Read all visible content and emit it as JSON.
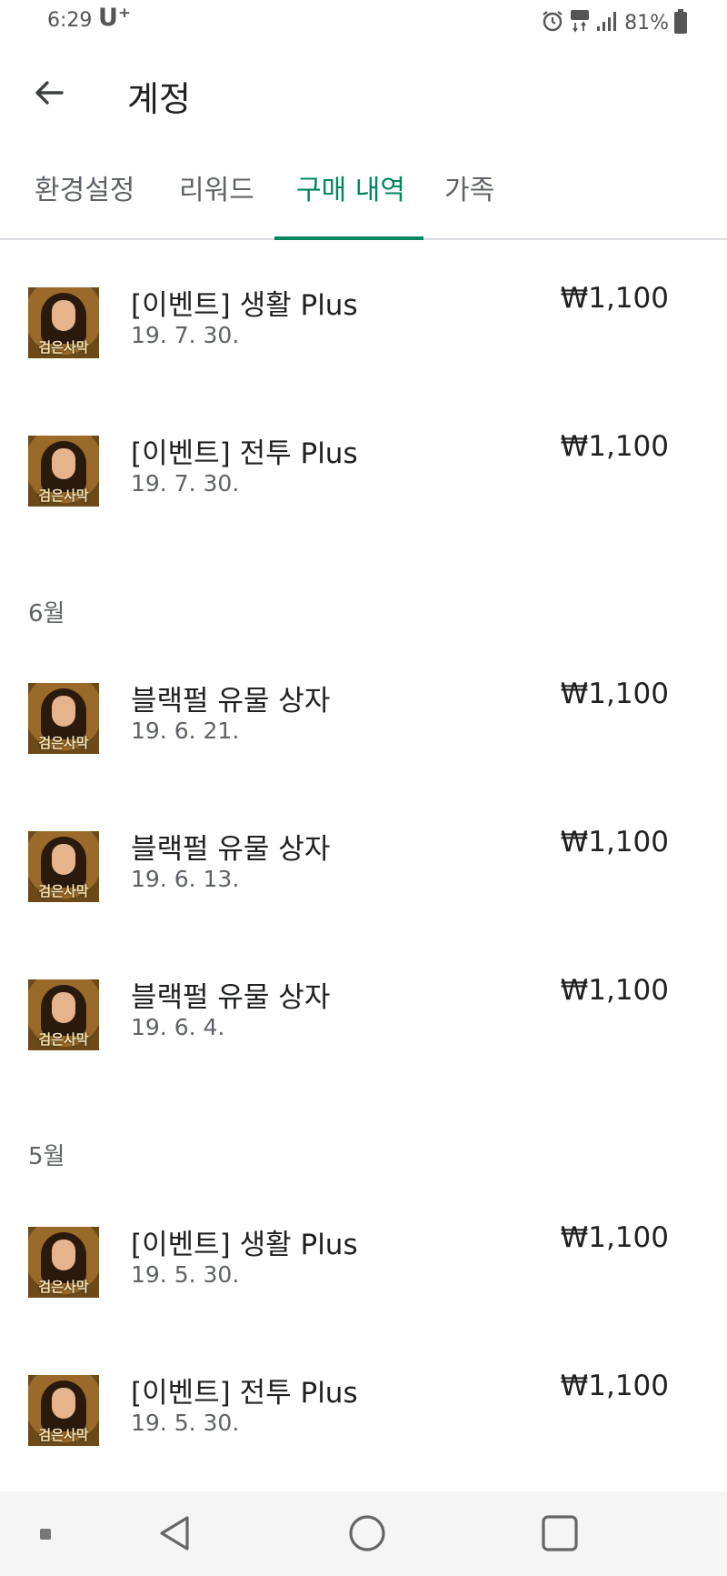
{
  "status_bar": {
    "time": "6:29",
    "carrier": "U⁺",
    "battery": "81%",
    "icons": [
      "alarm-icon",
      "lte-icon",
      "signal-icon",
      "battery-icon"
    ]
  },
  "app_bar": {
    "title": "계정",
    "back_icon": "arrow-left-icon"
  },
  "tabs": [
    {
      "label": "환경설정",
      "active": false
    },
    {
      "label": "리워드",
      "active": false
    },
    {
      "label": "구매 내역",
      "active": true
    },
    {
      "label": "가족",
      "active": false
    }
  ],
  "purchases": {
    "app_icon_label": "검은사막",
    "july": [
      {
        "title": "[이벤트] 생활 Plus",
        "date": "19. 7. 30.",
        "price": "₩1,100"
      },
      {
        "title": "[이벤트] 전투 Plus",
        "date": "19. 7. 30.",
        "price": "₩1,100"
      }
    ],
    "june_header": "6월",
    "june": [
      {
        "title": "블랙펄 유물 상자",
        "date": "19. 6. 21.",
        "price": "₩1,100"
      },
      {
        "title": "블랙펄 유물 상자",
        "date": "19. 6. 13.",
        "price": "₩1,100"
      },
      {
        "title": "블랙펄 유물 상자",
        "date": "19. 6. 4.",
        "price": "₩1,100"
      }
    ],
    "may_header": "5월",
    "may": [
      {
        "title": "[이벤트] 생활 Plus",
        "date": "19. 5. 30.",
        "price": "₩1,100"
      },
      {
        "title": "[이벤트] 전투 Plus",
        "date": "19. 5. 30.",
        "price": "₩1,100"
      }
    ]
  },
  "colors": {
    "accent": "#01875f",
    "text_primary": "#202124",
    "text_secondary": "#5f6368"
  },
  "nav_bar": {
    "buttons": [
      "dot-icon",
      "back-triangle-icon",
      "home-circle-icon",
      "recents-square-icon"
    ]
  }
}
